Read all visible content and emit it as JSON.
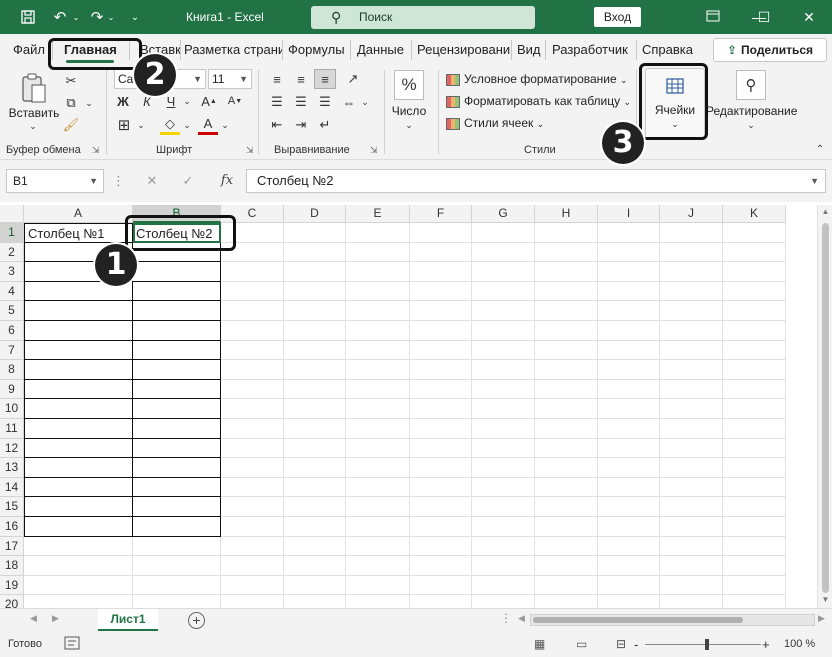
{
  "titlebar": {
    "save_icon": "save-icon",
    "undo_icon": "undo-icon",
    "redo_icon": "redo-icon",
    "title": "Книга1  -  Excel",
    "search_placeholder": "Поиск",
    "signin_label": "Вход",
    "window_controls": [
      "minimize",
      "maximize",
      "close"
    ]
  },
  "tabs": [
    {
      "label": "Файл"
    },
    {
      "label": "Главная",
      "active": true
    },
    {
      "label": "Вставка"
    },
    {
      "label": "Разметка страни"
    },
    {
      "label": "Формулы"
    },
    {
      "label": "Данные"
    },
    {
      "label": "Рецензировани"
    },
    {
      "label": "Вид"
    },
    {
      "label": "Разработчик"
    },
    {
      "label": "Справка"
    }
  ],
  "share_label": "Поделиться",
  "ribbon": {
    "clipboard": {
      "paste_label": "Вставить",
      "group_label": "Буфер обмена"
    },
    "font": {
      "font_name": "Calibri",
      "font_size": "11",
      "bold": "Ж",
      "italic": "К",
      "underline": "Ч",
      "group_label": "Шрифт"
    },
    "alignment": {
      "group_label": "Выравнивание"
    },
    "number": {
      "label": "Число",
      "icon_text": "%"
    },
    "styles": {
      "items": [
        "Условное форматирование",
        "Форматировать как таблицу",
        "Стили ячеек"
      ],
      "group_label": "Стили"
    },
    "cells": {
      "label": "Ячейки"
    },
    "editing": {
      "label": "Редактирование"
    }
  },
  "formula_bar": {
    "name_box": "B1",
    "cancel": "✕",
    "enter": "✓",
    "fx": "fx",
    "value": "Столбец №2"
  },
  "grid": {
    "columns": [
      "A",
      "B",
      "C",
      "D",
      "E",
      "F",
      "G",
      "H",
      "I",
      "J",
      "K"
    ],
    "rows": [
      "1",
      "2",
      "3",
      "4",
      "5",
      "6",
      "7",
      "8",
      "9",
      "10",
      "11",
      "12",
      "13",
      "14",
      "15",
      "16",
      "17",
      "18",
      "19",
      "20"
    ],
    "cells": {
      "A1": "Столбец №1",
      "B1": "Столбец №2"
    },
    "active_cell": "B1"
  },
  "sheets": [
    {
      "label": "Лист1"
    }
  ],
  "add_sheet_label": "+",
  "status": {
    "ready": "Готово",
    "zoom": "100 %",
    "zoom_minus": "-",
    "zoom_plus": "+"
  },
  "markers": [
    "1",
    "2",
    "3"
  ],
  "colors": {
    "accent": "#217346",
    "highlight": "#111111"
  }
}
